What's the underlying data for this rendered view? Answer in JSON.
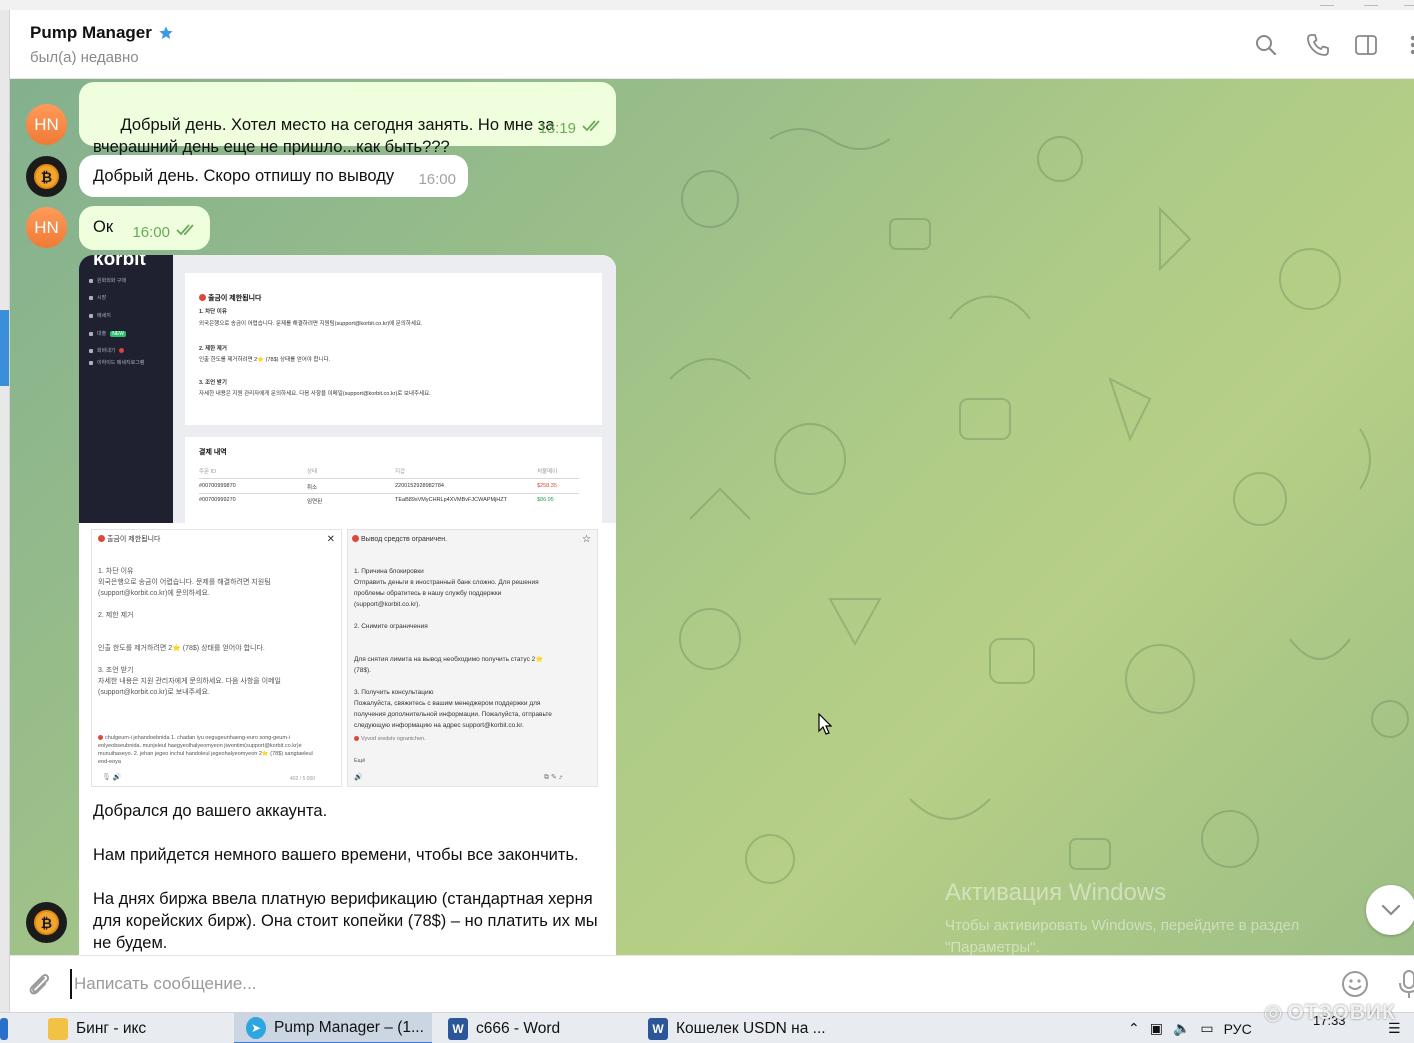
{
  "header": {
    "title": "Pump Manager",
    "status": "был(а) недавно"
  },
  "messages": [
    {
      "id": "m1",
      "avatar": "HN",
      "text": "Добрый день. Хотел место на сегодня занять. Но мне за\nвчерашний день еще не пришло...как быть???",
      "time": "13:19"
    },
    {
      "id": "m2",
      "text": "Добрый день. Скоро отпишу по выводу",
      "time": "16:00"
    },
    {
      "id": "m3",
      "avatar": "HN",
      "text": "Ок",
      "time": "16:00"
    }
  ],
  "media": {
    "korbit": {
      "logo": "korbit",
      "nav": [
        "원화외화 구매",
        "시장",
        "메세지",
        "대출",
        "회비내기",
        "이하이드 메세지로그램"
      ],
      "nav_badge": "NEW",
      "card_title": "출금이 제한됩니다",
      "lines": [
        "1. 차단 이유",
        "외국은행으로 송금이 어렵습니다. 문제를 해결하려면 지원팀(support@korbit.co.kr)에 문의하세요.",
        "2. 제한 제거",
        "인출 한도를 제거하려면 2⭐ (78$) 상태를 얻어야 합니다.",
        "3. 조언 받기",
        "자세한 내용은 지원 관리자에게 문의하세요. 다음 사항을 이메일(support@korbit.co.kr)로 보내주세요."
      ],
      "payments_title": "결제 내역",
      "payments_cols": [
        "주문 ID",
        "상태",
        "지갑",
        "처불메이"
      ],
      "payments_rows": [
        [
          "#00700999870",
          "취소",
          "2200152928982784",
          "$258.35"
        ],
        [
          "#00700999270",
          "임연된",
          "TEaB89sVMyCHRLp4XVMBvFJCWAPMjHZT",
          "$86.95"
        ]
      ]
    },
    "translate": {
      "left_title": "출금이 제한됩니다",
      "left_body": "1. 차단 이유\n외국은행으로 송금이 어렵습니다. 문제를 해결하려면 지원팀\n(support@korbit.co.kr)에 문의하세요.\n\n2. 제한 제거\n\n\n인출 한도를 제거하려면 2⭐ (78$) 상태를 얻어야 합니다.\n\n3. 조언 받기\n자세한 내용은 지원 관리자에게 문의하세요. 다음 사항을 이메일\n(support@korbit.co.kr)로 보내주세요.",
      "left_roman": "chulgeum-i jehandoebnida 1. chadan iyu oegugeunhaeng-euro song-geum-i eolyeobseubnida. munjeleul haegyeolhalyeomyeon jiwontim(support@korbit.co.kr)e munuihaseyo. 2. jehan jegeo inchul handoleul jegeohalyeomyeon 2⭐ (78$) sangtaeleul eod-eoya",
      "left_counter": "402 / 5 000",
      "right_title": "Вывод средств ограничен.",
      "right_body": "1. Причина блокировки\nОтправить деньги в иностранный банк сложно. Для решения\nпроблемы обратитесь в нашу службу поддержки\n(support@korbit.co.kr).\n\n2. Снимите ограничения\n\n\nДля снятия лимита на вывод необходимо получить статус 2⭐\n(78$).\n\n3. Получить консультацию\nПожалуйста, свяжитесь с вашим менеджером поддержки для\nполучения дополнительной информации. Пожалуйста, отправьте\nследующую информацию на адрес support@korbit.co.kr.",
      "right_roman": "Vyvod sredstv ogranichen.",
      "right_more": "Ещё"
    },
    "caption": "Добрался до вашего аккаунта.\n\nНам прийдется немного вашего времени, чтобы все закончить.\n\nНа днях биржа ввела платную верификацию (стандартная херня\nдля корейских бирж). Она стоит копейки (78$) – но платить их мы\nне будем."
  },
  "activation": {
    "title": "Активация Windows",
    "subtitle": "Чтобы активировать Windows, перейдите в раздел \"Параметры\"."
  },
  "composer": {
    "placeholder": "Написать сообщение..."
  },
  "taskbar": {
    "items": [
      {
        "label": "Бинг - икс",
        "icon": "folder-icon"
      },
      {
        "label": "Pump Manager – (1...",
        "icon": "telegram-icon",
        "active": true
      },
      {
        "label": "с666 - Word",
        "icon": "word-icon"
      },
      {
        "label": "Кошелек USDN на ...",
        "icon": "word-icon"
      }
    ],
    "lang": "РУС",
    "clock": "17:33"
  },
  "watermark": "ОТЗОВИК",
  "colors": {
    "accent": "#3a8fd9",
    "outgoing_bubble": "#effedd",
    "time_green": "#6aaa58",
    "hn_avatar": "#f58a45"
  }
}
